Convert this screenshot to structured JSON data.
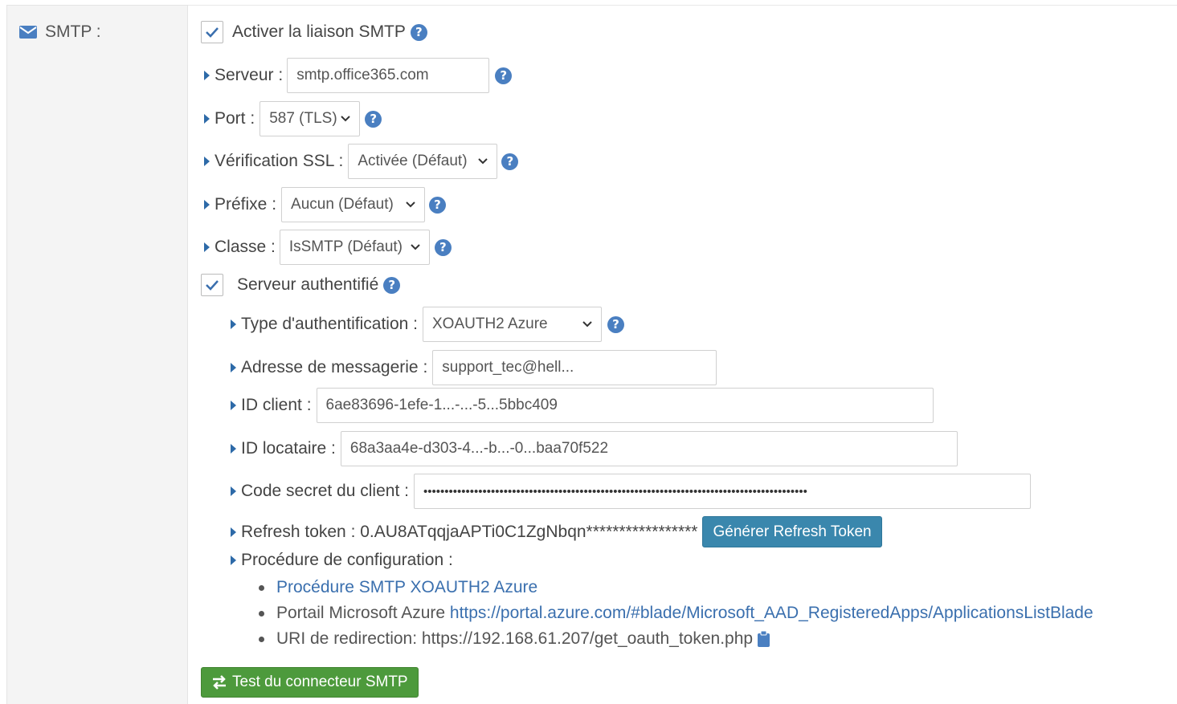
{
  "section": {
    "label": "SMTP :",
    "icon": "envelope-icon"
  },
  "enable_smtp": {
    "label": "Activer la liaison SMTP",
    "checked": true
  },
  "server": {
    "label": "Serveur :",
    "value": "smtp.office365.com"
  },
  "port": {
    "label": "Port :",
    "value": "587 (TLS)"
  },
  "ssl": {
    "label": "Vérification SSL :",
    "value": "Activée (Défaut)"
  },
  "prefix": {
    "label": "Préfixe :",
    "value": "Aucun (Défaut)"
  },
  "class": {
    "label": "Classe :",
    "value": "IsSMTP (Défaut)"
  },
  "auth_server": {
    "label": "Serveur authentifié",
    "checked": true
  },
  "auth_type": {
    "label": "Type d'authentification :",
    "value": "XOAUTH2 Azure"
  },
  "email": {
    "label": "Adresse de messagerie :",
    "value": "support_tec@hell..."
  },
  "client_id": {
    "label": "ID client :",
    "value": "6ae83696-1efe-1...-...-5...5bbc409"
  },
  "tenant_id": {
    "label": "ID locataire :",
    "value": "68a3aa4e-d303-4...-b...-0...baa70f522"
  },
  "client_secret": {
    "label": "Code secret du client :",
    "value": "•••••••••••••••••••••••••••••••••••••••••••••••••••••••••••••••••••••••••••••••••••••••••••"
  },
  "refresh_token": {
    "label": "Refresh token : 0.AU8ATqqjaAPTi0C1ZgNbqn*****************",
    "button": "Générer Refresh Token"
  },
  "config": {
    "label": "Procédure de configuration :",
    "items": [
      {
        "text": "",
        "link": "Procédure SMTP XOAUTH2 Azure"
      },
      {
        "text": "Portail Microsoft Azure ",
        "link": "https://portal.azure.com/#blade/Microsoft_AAD_RegisteredApps/ApplicationsListBlade"
      },
      {
        "text": "URI de redirection: https://192.168.61.207/get_oauth_token.php",
        "link": ""
      }
    ]
  },
  "test_button": {
    "label": "Test du connecteur SMTP"
  },
  "colors": {
    "accent": "#3a87ad",
    "success": "#4d9a3c",
    "help": "#4a7fc1",
    "link": "#3a6fae"
  }
}
